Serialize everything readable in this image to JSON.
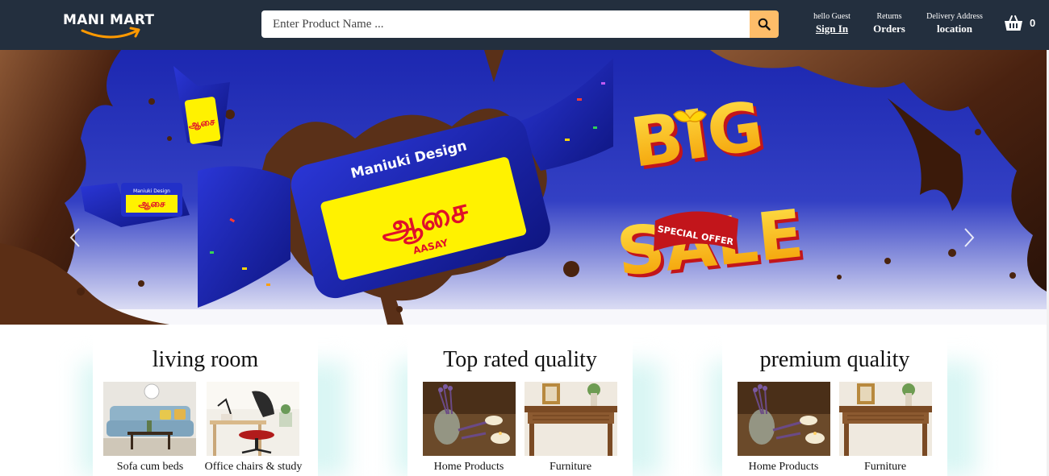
{
  "header": {
    "logo_text": "MANI MART",
    "search_placeholder": "Enter Product Name ...",
    "signin_small": "hello Guest",
    "signin_big": "Sign In",
    "orders_small": "Returns",
    "orders_big": "Orders",
    "location_small": "Delivery Address",
    "location_big": "location",
    "cart_count": "0"
  },
  "banner": {
    "candy_brand": "Maniuki Design",
    "candy_tamil": "ஆசை",
    "candy_latin": "AASAY",
    "sale_word_1": "BIG",
    "sale_word_2": "SALE",
    "ribbon_text": "SPECIAL OFFER"
  },
  "cards": [
    {
      "title": "living room",
      "items": [
        "Sofa cum beds",
        "Office chairs & study"
      ]
    },
    {
      "title": "Top rated quality",
      "items": [
        "Home Products",
        "Furniture"
      ]
    },
    {
      "title": "premium quality",
      "items": [
        "Home Products",
        "Furniture"
      ]
    }
  ],
  "colors": {
    "header_bg": "#232f3e",
    "search_button": "#febd69",
    "banner_blue": "#1f2bb8",
    "chocolate": "#5a3018",
    "candy_yellow": "#fff200",
    "card_glow": "#d9f6f4"
  },
  "icons": {
    "search": "search-icon",
    "cart": "basket-icon",
    "prev": "chevron-left-icon",
    "next": "chevron-right-icon"
  }
}
